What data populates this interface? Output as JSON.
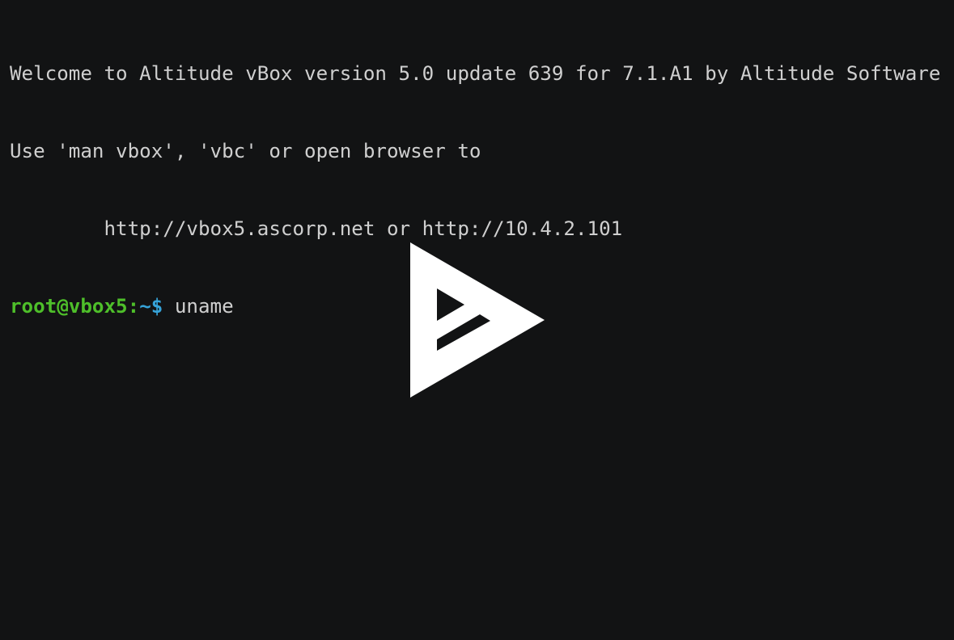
{
  "terminal": {
    "lines": [
      "Welcome to Altitude vBox version 5.0 update 639 for 7.1.A1 by Altitude Software",
      "Use 'man vbox', 'vbc' or open browser to",
      "        http://vbox5.ascorp.net or http://10.4.2.101"
    ],
    "prompt": {
      "user_host": "root@vbox5:",
      "path": "~$",
      "command": " uname"
    }
  },
  "player": {
    "icon": "asciinema-play-icon"
  },
  "colors": {
    "background": "#121314",
    "text": "#cfcfcf",
    "prompt_user": "#4ebf2a",
    "prompt_path": "#36a3d9",
    "play_icon": "#ffffff"
  }
}
